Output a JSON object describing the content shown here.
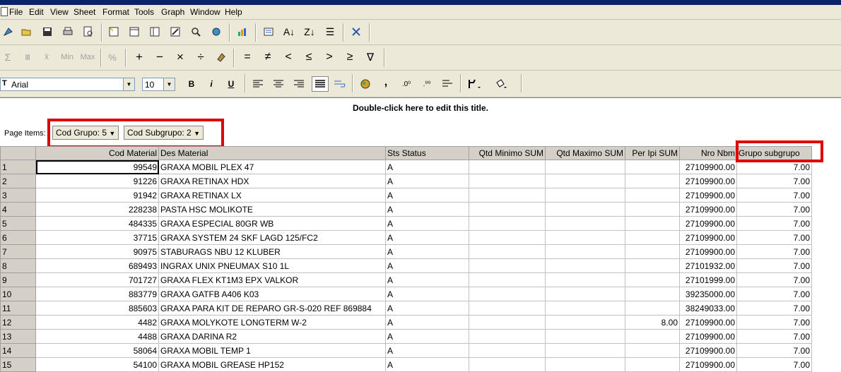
{
  "app": {
    "title": ""
  },
  "menu": [
    "File",
    "Edit",
    "View",
    "Sheet",
    "Format",
    "Tools",
    "Graph",
    "Window",
    "Help"
  ],
  "toolbar1": [
    "new-icon",
    "open-icon",
    "save-icon",
    "print-icon",
    "print-preview-icon",
    "sheet-wizard-icon",
    "table-icon",
    "columns-icon",
    "edit-icon",
    "zoom-icon",
    "globe-icon",
    "graph-icon",
    "outline-icon",
    "sort-ascending-icon",
    "sort-descending-icon",
    "indent-icon",
    "close-tool-icon"
  ],
  "toolbar2": {
    "sum": "Σ",
    "count": "Ⅲ",
    "avg": "x̄",
    "min": "Min",
    "max": "Max",
    "percent": "%",
    "plus": "+",
    "minus": "−",
    "times": "×",
    "divide": "÷",
    "equal": "=",
    "not_equal": "≠",
    "less": "<",
    "less_equal": "≤",
    "greater": ">",
    "greater_equal": "≥",
    "filter": "∇"
  },
  "toolbar3": {
    "font": "Arial",
    "size": "10",
    "bold": "B",
    "italic": "i",
    "underline": "U",
    "comma": ","
  },
  "report_title": "Double-click here to edit this title.",
  "page_items": {
    "label": "Page Items:",
    "grupo": "Cod Grupo: 5",
    "subgrupo": "Cod Subgrupo: 2"
  },
  "columns": [
    "",
    "Cod Material",
    "Des Material",
    "Sts Status",
    "Qtd Minimo SUM",
    "Qtd Maximo SUM",
    "Per Ipi SUM",
    "Nro Nbm",
    "Grupo  subgrupo"
  ],
  "rows": [
    {
      "n": "1",
      "cod": "99549",
      "des": "GRAXA MOBIL PLEX 47",
      "sts": "A",
      "min": "",
      "max": "",
      "ipi": "",
      "nbm": "27109900.00",
      "grp": "7.00"
    },
    {
      "n": "2",
      "cod": "91226",
      "des": "GRAXA RETINAX HDX",
      "sts": "A",
      "min": "",
      "max": "",
      "ipi": "",
      "nbm": "27109900.00",
      "grp": "7.00"
    },
    {
      "n": "3",
      "cod": "91942",
      "des": "GRAXA RETINAX LX",
      "sts": "A",
      "min": "",
      "max": "",
      "ipi": "",
      "nbm": "27109900.00",
      "grp": "7.00"
    },
    {
      "n": "4",
      "cod": "228238",
      "des": "PASTA HSC MOLIKOTE",
      "sts": "A",
      "min": "",
      "max": "",
      "ipi": "",
      "nbm": "27109900.00",
      "grp": "7.00"
    },
    {
      "n": "5",
      "cod": "484335",
      "des": "GRAXA ESPECIAL 80GR WB",
      "sts": "A",
      "min": "",
      "max": "",
      "ipi": "",
      "nbm": "27109900.00",
      "grp": "7.00"
    },
    {
      "n": "6",
      "cod": "37715",
      "des": "GRAXA SYSTEM 24 SKF LAGD 125/FC2",
      "sts": "A",
      "min": "",
      "max": "",
      "ipi": "",
      "nbm": "27109900.00",
      "grp": "7.00"
    },
    {
      "n": "7",
      "cod": "90975",
      "des": "STABURAGS NBU 12 KLUBER",
      "sts": "A",
      "min": "",
      "max": "",
      "ipi": "",
      "nbm": "27109900.00",
      "grp": "7.00"
    },
    {
      "n": "8",
      "cod": "689493",
      "des": "INGRAX UNIX PNEUMAX S10 1L",
      "sts": "A",
      "min": "",
      "max": "",
      "ipi": "",
      "nbm": "27101932.00",
      "grp": "7.00"
    },
    {
      "n": "9",
      "cod": "701727",
      "des": "GRAXA FLEX KT1M3 EPX VALKOR",
      "sts": "A",
      "min": "",
      "max": "",
      "ipi": "",
      "nbm": "27101999.00",
      "grp": "7.00"
    },
    {
      "n": "10",
      "cod": "883779",
      "des": "GRAXA GATFB A406 K03",
      "sts": "A",
      "min": "",
      "max": "",
      "ipi": "",
      "nbm": "39235000.00",
      "grp": "7.00"
    },
    {
      "n": "11",
      "cod": "885603",
      "des": "GRAXA PARA KIT DE REPARO GR-S-020 REF 869884",
      "sts": "A",
      "min": "",
      "max": "",
      "ipi": "",
      "nbm": "38249033.00",
      "grp": "7.00"
    },
    {
      "n": "12",
      "cod": "4482",
      "des": "GRAXA MOLYKOTE LONGTERM W-2",
      "sts": "A",
      "min": "",
      "max": "",
      "ipi": "8.00",
      "nbm": "27109900.00",
      "grp": "7.00"
    },
    {
      "n": "13",
      "cod": "4488",
      "des": "GRAXA DARINA R2",
      "sts": "A",
      "min": "",
      "max": "",
      "ipi": "",
      "nbm": "27109900.00",
      "grp": "7.00"
    },
    {
      "n": "14",
      "cod": "58064",
      "des": "GRAXA MOBIL TEMP 1",
      "sts": "A",
      "min": "",
      "max": "",
      "ipi": "",
      "nbm": "27109900.00",
      "grp": "7.00"
    },
    {
      "n": "15",
      "cod": "54100",
      "des": "GRAXA MOBIL GREASE HP152",
      "sts": "A",
      "min": "",
      "max": "",
      "ipi": "",
      "nbm": "27109900.00",
      "grp": "7.00"
    }
  ],
  "highlight_color": "#e00000"
}
